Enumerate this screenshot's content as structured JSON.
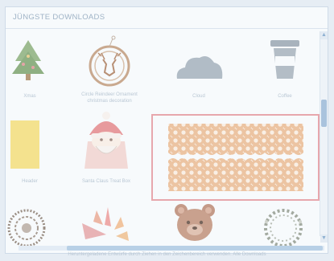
{
  "panel": {
    "title": "JÜNGSTE DOWNLOADS"
  },
  "tiles": [
    {
      "label": "Xmas",
      "icon": "christmas-tree-icon"
    },
    {
      "label": "Circle Reindeer Ornament christmas decoration",
      "icon": "reindeer-ornament-icon"
    },
    {
      "label": "Cloud",
      "icon": "cloud-icon"
    },
    {
      "label": "Coffee",
      "icon": "coffee-cup-icon"
    },
    {
      "label": "Header",
      "icon": "yellow-card-icon"
    },
    {
      "label": "Santa Claus Treat Box",
      "icon": "santa-box-icon"
    },
    {
      "label": "",
      "icon": "lace-border-icon"
    },
    {
      "label": "",
      "icon": "doily-icon"
    },
    {
      "label": "",
      "icon": "sparkle-icon"
    },
    {
      "label": "",
      "icon": "teddy-bear-icon"
    },
    {
      "label": "",
      "icon": "wreath-icon"
    }
  ],
  "footer": {
    "hint": "Heruntergeladene Entwürfe durch Ziehen in den Zeichenbereich verwenden. Alle Downloads"
  },
  "scroll": {
    "up": "▲",
    "down": "▼"
  },
  "colors": {
    "selection": "#e7a7ad",
    "accent": "#a9c3dd",
    "lace": "#e9b98f"
  }
}
